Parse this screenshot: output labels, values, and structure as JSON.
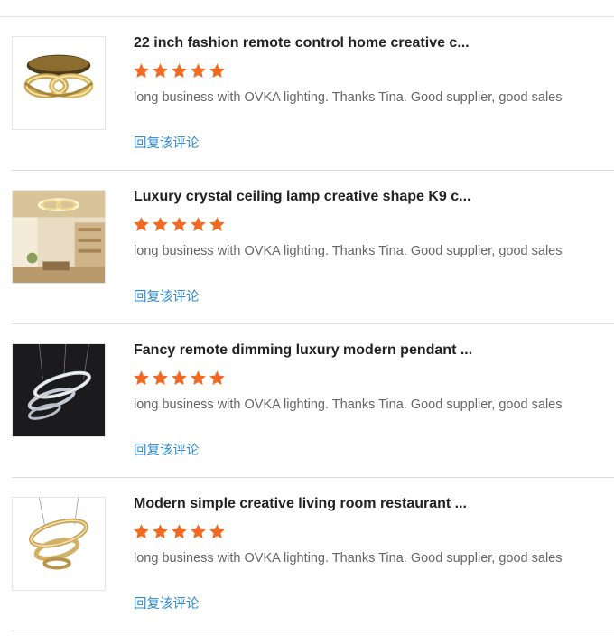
{
  "reviews": [
    {
      "image": "gold-crystal-ring-ceiling-lamp",
      "title": "22 inch fashion remote control home creative c...",
      "rating": 5,
      "comment": "long business with OVKA lighting. Thanks Tina. Good supplier, good sales",
      "reply_label": "回复该评论"
    },
    {
      "image": "crystal-ceiling-lamp-in-room",
      "title": "Luxury crystal ceiling lamp creative shape K9 c...",
      "rating": 5,
      "comment": "long business with OVKA lighting. Thanks Tina. Good supplier, good sales",
      "reply_label": "回复该评论"
    },
    {
      "image": "three-ring-pendant-on-dark",
      "title": "Fancy remote dimming luxury modern pendant ...",
      "rating": 5,
      "comment": "long business with OVKA lighting. Thanks Tina. Good supplier, good sales",
      "reply_label": "回复该评论"
    },
    {
      "image": "gold-three-ring-pendant",
      "title": "Modern simple creative living room restaurant ...",
      "rating": 5,
      "comment": "long business with OVKA lighting. Thanks Tina. Good supplier, good sales",
      "reply_label": "回复该评论"
    }
  ],
  "colors": {
    "star": "#f26a21",
    "reply_link": "#2f8bcf",
    "title": "#222222",
    "comment": "#666666"
  }
}
